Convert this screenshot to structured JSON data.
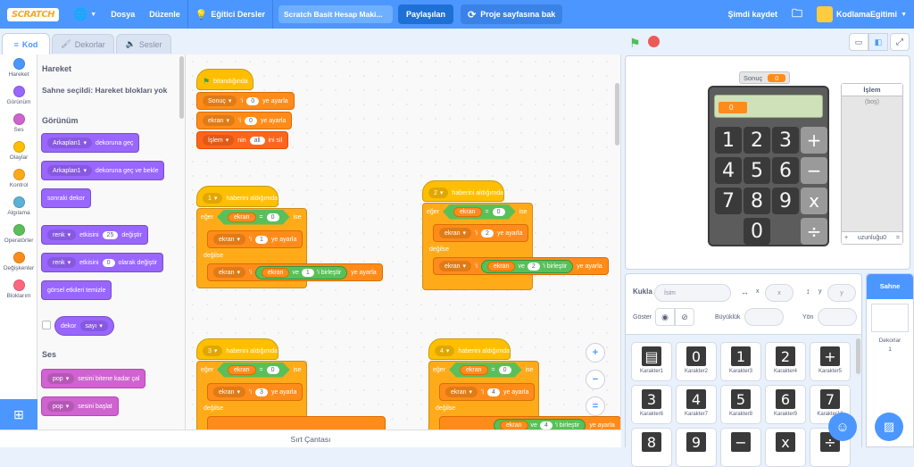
{
  "menu": {
    "logo": "SCRATCH",
    "language": "",
    "file": "Dosya",
    "edit": "Düzenle",
    "tutorials": "Eğitici Dersler",
    "project_title": "Scratch Basit Hesap Maki...",
    "share": "Paylaşılan",
    "see_project": "Proje sayfasına bak",
    "save_now": "Şimdi kaydet",
    "username": "KodlamaEgitimi"
  },
  "tabs": {
    "code": "Kod",
    "costumes": "Dekorlar",
    "sounds": "Sesler"
  },
  "categories": [
    {
      "label": "Hareket",
      "color": "#4c97ff"
    },
    {
      "label": "Görünüm",
      "color": "#9966ff"
    },
    {
      "label": "Ses",
      "color": "#cf63cf"
    },
    {
      "label": "Olaylar",
      "color": "#ffbf00"
    },
    {
      "label": "Kontrol",
      "color": "#ffab19"
    },
    {
      "label": "Algılama",
      "color": "#5cb1d6"
    },
    {
      "label": "Operatörler",
      "color": "#59c059"
    },
    {
      "label": "Değişkenler",
      "color": "#ff8c1a"
    },
    {
      "label": "Bloklarım",
      "color": "#ff6680"
    }
  ],
  "palette": {
    "motion_header": "Hareket",
    "motion_note": "Sahne seçildi: Hareket blokları yok",
    "looks_header": "Görünüm",
    "b1_dd": "Arkaplan1",
    "b1_txt": "dekoruna geç",
    "b2_dd": "Arkaplan1",
    "b2_txt": "dekoruna geç ve bekle",
    "b3_txt": "sonraki dekor",
    "b4_dd": "renk",
    "b4_txt1": "etkisini",
    "b4_num": "25",
    "b4_txt2": "değiştir",
    "b5_dd": "renk",
    "b5_txt1": "etkisini",
    "b5_num": "0",
    "b5_txt2": "olarak değiştir",
    "b6_txt": "görsel etkileri temizle",
    "b7_dd": "dekor",
    "b7_dd2": "sayı",
    "sound_header": "Ses",
    "b8_dd": "pop",
    "b8_txt": "sesini bitene kadar çal",
    "b9_dd": "pop",
    "b9_txt": "sesini başlat"
  },
  "scripts": {
    "s1": {
      "hat": "bitandığında",
      "r1_var": "Sonuç",
      "r1_mid": "'i",
      "r1_num": "0",
      "r1_end": "ye ayarla",
      "r2_var": "ekran",
      "r2_mid": "'i",
      "r2_num": "0",
      "r2_end": "ye ayarla",
      "r3_var": "İşlem",
      "r3_mid": "nin",
      "r3_num": "all",
      "r3_end": "ini sil"
    },
    "s2": {
      "hat_dd": "1",
      "hat": "haberini aldığımda",
      "if": "eğer",
      "cond_var": "ekran",
      "eq": "=",
      "cond_val": "0",
      "then": "ise",
      "set_var": "ekran",
      "set_mid": "'i",
      "set_num": "1",
      "set_end": "ye ayarla",
      "else": "değilse",
      "set2_var": "ekran",
      "set2_mid": "'i",
      "join_var": "ekran",
      "join_and": "ve",
      "join_num": "1",
      "join_txt": "'i birleştir",
      "set2_end": "ye ayarla"
    },
    "s3": {
      "hat_dd": "2",
      "hat": "haberini aldığımda",
      "if": "eğer",
      "cond_var": "ekran",
      "eq": "=",
      "cond_val": "0",
      "then": "ise",
      "set_var": "ekran",
      "set_mid": "'i",
      "set_num": "2",
      "set_end": "ye ayarla",
      "else": "değilse",
      "set2_var": "ekran",
      "set2_mid": "'i",
      "join_var": "ekran",
      "join_and": "ve",
      "join_num": "2",
      "join_txt": "'i birleştir",
      "set2_end": "ye ayarla"
    },
    "s4": {
      "hat_dd": "3",
      "hat": "haberini aldığımda",
      "if": "eğer",
      "cond_var": "ekran",
      "eq": "=",
      "cond_val": "0",
      "then": "ise",
      "set_var": "ekran",
      "set_mid": "'i",
      "set_num": "3",
      "set_end": "ye ayarla",
      "else": "değilse"
    },
    "s5": {
      "hat_dd": "4",
      "hat": "haberini aldığımda",
      "if": "eğer",
      "cond_var": "ekran",
      "eq": "=",
      "cond_val": "0",
      "then": "ise",
      "set_var": "ekran",
      "set_mid": "'i",
      "set_num": "4",
      "set_end": "ye ayarla",
      "else": "değilse",
      "join_var": "ekran",
      "join_and": "ve",
      "join_num": "4",
      "join_txt": "'i birleştir",
      "set2_end": "ye ayarla"
    }
  },
  "zoom": {
    "in": "+",
    "out": "−",
    "reset": "="
  },
  "backpack": "Sırt Çantası",
  "stage": {
    "monitor_label": "Sonuç",
    "monitor_value": "0",
    "display": "0",
    "keys": [
      "1",
      "2",
      "3",
      "+",
      "4",
      "5",
      "6",
      "−",
      "7",
      "8",
      "9",
      "x",
      "0",
      "÷"
    ],
    "list_title": "İşlem",
    "list_empty": "(boş)",
    "list_add": "+",
    "list_length": "uzunluğu0",
    "list_eq": "="
  },
  "sprite": {
    "label": "Kukla",
    "name_placeholder": "İsim",
    "x_label": "x",
    "x_val": "x",
    "y_label": "y",
    "y_val": "y",
    "show": "Göster",
    "size": "Büyüklük",
    "direction": "Yön"
  },
  "sprites": [
    {
      "name": "Karakter1",
      "glyph": "▤"
    },
    {
      "name": "Karakter2",
      "glyph": "0"
    },
    {
      "name": "Karakter3",
      "glyph": "1"
    },
    {
      "name": "Karakter4",
      "glyph": "2"
    },
    {
      "name": "Karakter5",
      "glyph": "+"
    },
    {
      "name": "Karakter6",
      "glyph": "3"
    },
    {
      "name": "Karakter7",
      "glyph": "4"
    },
    {
      "name": "Karakter8",
      "glyph": "5"
    },
    {
      "name": "Karakter9",
      "glyph": "6"
    },
    {
      "name": "Karakter10",
      "glyph": "7"
    },
    {
      "name": "",
      "glyph": "8"
    },
    {
      "name": "",
      "glyph": "9"
    },
    {
      "name": "",
      "glyph": "−"
    },
    {
      "name": "",
      "glyph": "x"
    },
    {
      "name": "",
      "glyph": "÷"
    }
  ],
  "stage_pane": {
    "title": "Sahne",
    "backdrops": "Dekorlar",
    "count": "1"
  }
}
